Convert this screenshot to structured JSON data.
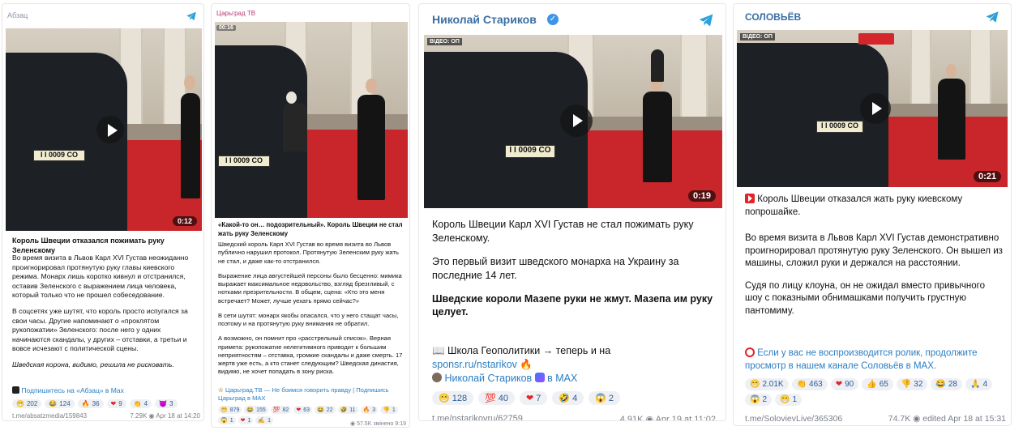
{
  "posts": [
    {
      "channel": "Абзац",
      "channel_color": "#8b96a8",
      "duration": "0:12",
      "title": "Король Швеции отказался пожимать руку Зеленскому",
      "paragraphs": [
        "Во время визита в Львов Карл XVI Густав неожиданно проигнорировал протянутую руку главы киевского режима. Монарх лишь коротко кивнул и отстранился, оставив Зеленского с выражением лица человека, который только что не прошел собеседование.",
        "В соцсетях уже шутят, что король просто испугался за свои часы. Другие напоминают о «проклятом рукопожатии» Зеленского: после него у одних начинаются скандалы, у других – отставки, а третьи и вовсе исчезают с политической сцены.",
        "Шведская корона, видимо, решила не рисковать."
      ],
      "subscribe": "Подпишитесь на «Абзац» в Max",
      "reactions": [
        {
          "icon": "😁",
          "count": "202"
        },
        {
          "icon": "😂",
          "count": "124"
        },
        {
          "icon": "🔥",
          "count": "36"
        },
        {
          "icon": "❤",
          "count": "9"
        },
        {
          "icon": "👏",
          "count": "4"
        },
        {
          "icon": "😈",
          "count": "3"
        }
      ],
      "link": "t.me/absatzmedia/159843",
      "views": "7.29K",
      "date": "Apr 18 at 14:20",
      "plate": "I I 0009 CO"
    },
    {
      "channel": "Царьград ТВ",
      "channel_color": "#b53a74",
      "time_label": "00:16",
      "title": "«Какой-то он… подозрительный». Король Швеции не стал жать руку Зеленскому",
      "paragraphs": [
        "Шведский король Карл XVI Густав во время визита во Львов публично нарушил протокол. Протянутую Зеленским руку жать не стал, и даже как-то отстранился.",
        "Выражение лица августейшей персоны было бесценно: мимика выражает максимальное недовольство, взгляд брезгливый, с нотками презрительности. В общем, сцена: «Кто это меня встречает? Может, лучше уехать прямо сейчас?»",
        "В сети шутят: монарх якобы опасался, что у него стащат часы, поэтому и на протянутую руку внимания не обратил.",
        "А возможно, он помнит про «расстрельный список». Верная примета: рукопожатие нелегитимного приводит к большим неприятностям – отставка, громкие скандалы и даже смерть. 17 жертв уже есть, а кто станет следующим? Шведская династия, видимо, не хочет попадать в зону риска."
      ],
      "subscribe": "Царьград.ТВ — Не боимся говорить правду | Подпишись Царьград в MAX",
      "reactions": [
        {
          "icon": "😁",
          "count": "879"
        },
        {
          "icon": "😂",
          "count": "155"
        },
        {
          "icon": "💯",
          "count": "82"
        },
        {
          "icon": "❤",
          "count": "63"
        },
        {
          "icon": "😂",
          "count": "22"
        },
        {
          "icon": "🤣",
          "count": "11"
        },
        {
          "icon": "🔥",
          "count": "3"
        },
        {
          "icon": "👎",
          "count": "1"
        },
        {
          "icon": "😱",
          "count": "1"
        },
        {
          "icon": "❤",
          "count": "1"
        },
        {
          "icon": "✍",
          "count": "1"
        }
      ],
      "views": "57.5K",
      "date": "змінено 9:19",
      "plate": "I I 0009 CO"
    },
    {
      "channel": "Николай Стариков",
      "channel_color": "#3a6ea5",
      "video_tag": "ВІДЕО: ОП",
      "duration": "0:19",
      "paragraphs": [
        "Король Швеции Карл XVI Густав не стал пожимать руку Зеленскому.",
        "Это первый визит шведского монарха на Украину за последние 14 лет."
      ],
      "bold_text": "Шведские короли Мазепе руки не жмут. Мазепа им руку целует.",
      "promo_line1": "📖 Школа Геополитики → теперь и на",
      "promo_link": "sponsr.ru/nstarikov",
      "promo_line2": "Николай Стариков",
      "promo_max": "в MAX",
      "reactions": [
        {
          "icon": "😁",
          "count": "128"
        },
        {
          "icon": "💯",
          "count": "40"
        },
        {
          "icon": "❤",
          "count": "7"
        },
        {
          "icon": "🤣",
          "count": "4"
        },
        {
          "icon": "😱",
          "count": "2"
        }
      ],
      "link": "t.me/nstarikovru/62759",
      "views": "4.91K",
      "date": "Apr 19 at 11:02",
      "plate": "I I 0009 CO"
    },
    {
      "channel": "СОЛОВЬЁВ",
      "channel_color": "#3a6ea5",
      "video_tag": "ВІДЕО: ОП",
      "duration": "0:21",
      "headline": "Король Швеции отказался жать руку киевскому попрошайке.",
      "paragraphs": [
        "Во время визита в Львов Карл XVI Густав демонстративно проигнорировал протянутую руку Зеленского. Он вышел из машины, сложил руки и держался на расстоянии.",
        "Судя по лицу клоуна, он не ожидал вместо привычного шоу с показными обнимашками получить грустную пантомиму."
      ],
      "promo": "Если у вас не воспроизводится ролик, продолжите просмотр в нашем канале Соловьёв в MAX.",
      "reactions": [
        {
          "icon": "😁",
          "count": "2.01K"
        },
        {
          "icon": "👏",
          "count": "463"
        },
        {
          "icon": "❤",
          "count": "90"
        },
        {
          "icon": "👍",
          "count": "65"
        },
        {
          "icon": "👎",
          "count": "32"
        },
        {
          "icon": "😂",
          "count": "28"
        },
        {
          "icon": "🙏",
          "count": "4"
        },
        {
          "icon": "😱",
          "count": "2"
        },
        {
          "icon": "😁",
          "count": "1"
        }
      ],
      "link": "t.me/SolovievLive/365306",
      "views": "74.7K",
      "date": "edited Apr 18 at 15:31",
      "plate": "I I 0009 CO"
    }
  ]
}
